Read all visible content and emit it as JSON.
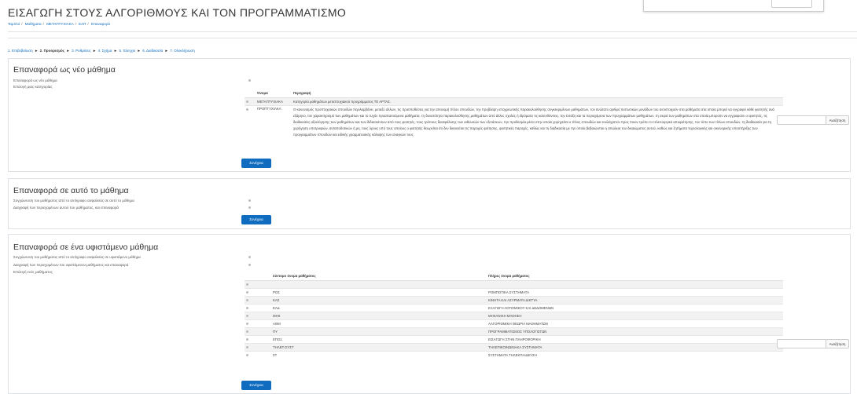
{
  "page": {
    "title": "ΕΙΣΑΓΩΓΗ ΣΤΟΥΣ ΑΛΓΟΡΙΘΜΟΥΣ ΚΑΙ ΤΟΝ ΠΡΟΓΡΑΜΜΑΤΙΣΜΟ",
    "breadcrumb": [
      "Ταμπλό",
      "Μαθήματα",
      "ΜΕΤΑΠΤΥΧΙΑΚΑ",
      "ΕΑΠ",
      "Επαναφορά"
    ],
    "steps": [
      {
        "label": "1. Επιβεβαίωση",
        "current": false
      },
      {
        "label": "2. Προορισμός",
        "current": true
      },
      {
        "label": "3. Ρυθμίσεις",
        "current": false
      },
      {
        "label": "4. Σχήμα",
        "current": false
      },
      {
        "label": "5. Έλεγχοι",
        "current": false
      },
      {
        "label": "6. Διαδικασία",
        "current": false
      },
      {
        "label": "7. Ολοκλήρωση",
        "current": false
      }
    ]
  },
  "section_new": {
    "heading": "Επαναφορά ως νέο μάθημα",
    "option_label": "Επαναφορά ως νέο μάθημα",
    "select_label": "Επιλογή μιας κατηγορίας",
    "col_name": "Όνομα",
    "col_desc": "Περιγραφή",
    "rows": [
      {
        "name": "ΜΕΤΑΠΤΥΧΙΑΚΑ",
        "desc": "Κατηγορία μαθημάτων μεταπτυχιακού προγράμματος ΤΕ ΑΡΤΑΣ."
      },
      {
        "name": "ΠΡΟΠΤΥΧΙΑΚΑ",
        "desc": "Ο κανονισμός προπτυχιακών σπουδών περιλαμβάνει, μεταξύ άλλων, τις προϋποθέσεις για την απονομή τίτλου σπουδών, την προβλεψη υποχρεωτικής παρακολούθησης συγκεκριμένων μαθημάτων, τον ανώτατο αριθμό πιστωτικών μονάδων του αντιστοιχούν στα μαθήματα στα οποία μπορεί να εγγραφεί κάθε φοιτητής ανά εξάμηνο, τον χαρακτηρισμό των μαθημάτων και το τυχόν προαπαιτούμενα μαθήματα, τη δυνατότητα παρακολούθησης μαθημάτων από άλλες σχολές ή ιδρύματα τις κατευθύνσεις, την ένταξη και τα περιεχόμενα των προγραμμάτων μαθημάτων, τη σειρά των μαθημάτων στα οποία μπορούν να εγγραφούν οι φοιτητές, τις διαδικασίες αξιολόγησης των μαθημάτων και των διδασκόντων από τους φοιτητές, τους τρόπους διασφάλισης των αιθουσών των εξετάσεων, την προθεσμία μέσα στην οποία χορηγείται ο τίτλος σπουδών και τουλάχιστον προς ποιον τρόπο το τελετουργικό αποφοίτησης, τον τύπο των τίτλων σπουδών, τη διαδικασία για τη χορήγηση υποτροφιών, ανταποδοτικών ή μη, τους όρους υπό τους οποίους ο φοιτητής θεωρείται ότι δεν δικαιούται τις παροχές φοίτησης, φοιτητικές παροχές, καθώς και τη διαδικασία με την οποία βεβαιώνεται η απώλεια του δικαιώματος αυτού, καθώς και ζητήματα τεχνολογικής και οικονομικής υποστήριξης των προγραμμάτων σπουδών και ειδικής γραμματειακής κάλυψης των αναγκών τους."
      }
    ],
    "search_placeholder": "",
    "search_button": "Αναζήτηση",
    "continue": "Συνέχεια"
  },
  "section_this": {
    "heading": "Επαναφορά σε αυτό το μάθημα",
    "options": [
      "Συγχώνευση του μαθήματος από το αντίγραφο ασφαλείας σε αυτό το μάθημα",
      "Διαγραφή των περιεχομένων αυτού του μαθήματος, και επαναφορά"
    ],
    "continue": "Συνέχεια"
  },
  "section_existing": {
    "heading": "Επαναφορά σε ένα υφιστάμενο μάθημα",
    "options": [
      "Συγχώνευση του μαθήματος από το αντίγραφο ασφαλείας σε υφιστάμενο μάθημα",
      "Διαγραφή των περιεχομένων του υφιστάμενου μαθήματος και επαναφορά"
    ],
    "select_label": "Επιλογή ενός μαθήματος",
    "col_short": "Σύντομο όνομα μαθήματος",
    "col_full": "Πλήρες όνομα μαθήματος",
    "rows": [
      {
        "short": "",
        "full": ""
      },
      {
        "short": "ΡΟΣ",
        "full": "ΡΟΜΠΟΤΙΚΑ ΣΥΣΤΗΜΑΤΑ"
      },
      {
        "short": "ΚΑΣ",
        "full": "ΚΙΝΗΤΑ ΚΑΙ ΑΣΥΡΜΑΤΑ ΔΙΚΤΥΑ"
      },
      {
        "short": "ΕΛΔ",
        "full": "ΕΞΑΓΩΓΗ ΛΟΓΙΣΜΙΚΟΥ ΚΑΙ ΔΕΔΟΜΕΝΩΝ"
      },
      {
        "short": "ΜΗΧ",
        "full": "ΜΗΧΑΝΙΚΗ ΜΑΘΗΣΗ"
      },
      {
        "short": "ΑΘΜ",
        "full": "ΑΛΓΟΡΙΘΜΙΚΗ ΘΕΩΡΙΑ ΜΑΘΗΜΑΤΩΝ"
      },
      {
        "short": "ΠΥ",
        "full": "ΠΡΟΓΡΑΜΜΑΤΙΣΜΟΣ ΥΠΟΛΟΓΙΣΤΩΝ"
      },
      {
        "short": "ΕΠΟ1",
        "full": "ΕΙΣΑΓΩΓΗ ΣΤΗΝ ΠΛΗΡΟΦΟΡΙΚΗ"
      },
      {
        "short": "ΤΗΛΕΠ ΣΥΣΤ",
        "full": "ΤΗΛΕΠΙΚΟΙΝΩΝΙΑΚΑ ΣΥΣΤΗΜΑΤΑ"
      },
      {
        "short": "ΣΤ",
        "full": "ΣΥΣΤΗΜΑΤΑ ΤΗΛΕΚΠΑΙΔΕΥΣΗ"
      }
    ],
    "search_placeholder": "",
    "search_button": "Αναζήτηση",
    "continue": "Συνέχεια"
  }
}
